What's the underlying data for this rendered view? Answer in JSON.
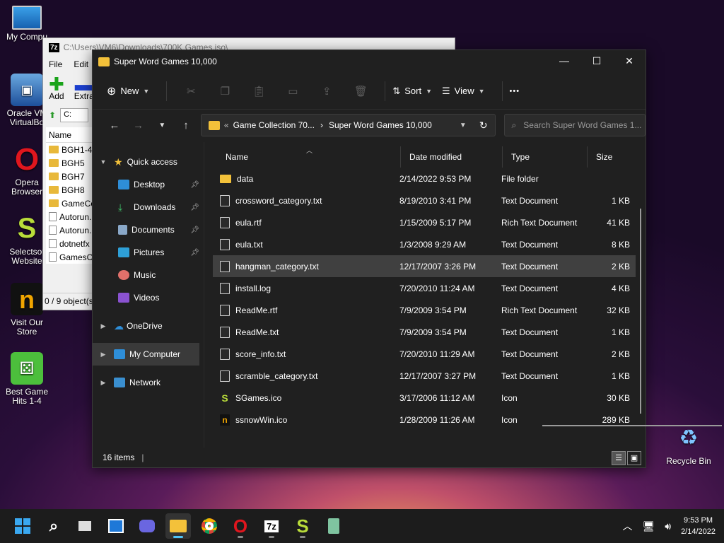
{
  "desktop": {
    "icons": [
      {
        "label": "My Compu",
        "icon": "monitor-icon"
      },
      {
        "label": "Oracle VM VirtualBo",
        "icon": "virtualbox-icon"
      },
      {
        "label": "Opera Browser",
        "icon": "opera-icon"
      },
      {
        "label": "Selectsof Website",
        "icon": "selectsoft-icon"
      },
      {
        "label": "Visit Our Store",
        "icon": "store-icon"
      },
      {
        "label": "Best Game Hits 1-4",
        "icon": "dice-icon"
      },
      {
        "label": "Recycle Bin",
        "icon": "recycle-bin-icon"
      }
    ]
  },
  "zip_window": {
    "title": "C:\\Users\\VM6\\Downloads\\700K Games.iso\\",
    "logo": "7z",
    "menu": [
      "File",
      "Edit"
    ],
    "toolbar": {
      "add": "Add",
      "extract": "Extra"
    },
    "addr_label": "C:",
    "list_header": "Name",
    "items": [
      "BGH1-4",
      "BGH5",
      "BGH7",
      "BGH8",
      "GameCo",
      "Autorun.",
      "Autorun.",
      "dotnetfx",
      "GamesC"
    ],
    "status": "0 / 9 object(s"
  },
  "explorer": {
    "title": "Super Word Games 10,000",
    "toolbar": {
      "new": "New",
      "sort": "Sort",
      "view": "View",
      "more": "•••"
    },
    "breadcrumb": {
      "prefix": "«",
      "parent": "Game Collection 70...",
      "current": "Super Word Games 10,000"
    },
    "search_placeholder": "Search Super Word Games 1...",
    "nav": {
      "quick_access": "Quick access",
      "items": [
        "Desktop",
        "Downloads",
        "Documents",
        "Pictures",
        "Music",
        "Videos"
      ],
      "onedrive": "OneDrive",
      "my_computer": "My Computer",
      "network": "Network"
    },
    "columns": {
      "name": "Name",
      "date": "Date modified",
      "type": "Type",
      "size": "Size"
    },
    "files": [
      {
        "name": "data",
        "date": "2/14/2022 9:53 PM",
        "type": "File folder",
        "size": "",
        "kind": "folder"
      },
      {
        "name": "crossword_category.txt",
        "date": "8/19/2010 3:41 PM",
        "type": "Text Document",
        "size": "1 KB",
        "kind": "doc"
      },
      {
        "name": "eula.rtf",
        "date": "1/15/2009 5:17 PM",
        "type": "Rich Text Document",
        "size": "41 KB",
        "kind": "doc"
      },
      {
        "name": "eula.txt",
        "date": "1/3/2008 9:29 AM",
        "type": "Text Document",
        "size": "8 KB",
        "kind": "doc"
      },
      {
        "name": "hangman_category.txt",
        "date": "12/17/2007 3:26 PM",
        "type": "Text Document",
        "size": "2 KB",
        "kind": "doc"
      },
      {
        "name": "install.log",
        "date": "7/20/2010 11:24 AM",
        "type": "Text Document",
        "size": "4 KB",
        "kind": "doc"
      },
      {
        "name": "ReadMe.rtf",
        "date": "7/9/2009 3:54 PM",
        "type": "Rich Text Document",
        "size": "32 KB",
        "kind": "doc"
      },
      {
        "name": "ReadMe.txt",
        "date": "7/9/2009 3:54 PM",
        "type": "Text Document",
        "size": "1 KB",
        "kind": "doc"
      },
      {
        "name": "score_info.txt",
        "date": "7/20/2010 11:29 AM",
        "type": "Text Document",
        "size": "2 KB",
        "kind": "doc"
      },
      {
        "name": "scramble_category.txt",
        "date": "12/17/2007 3:27 PM",
        "type": "Text Document",
        "size": "1 KB",
        "kind": "doc"
      },
      {
        "name": "SGames.ico",
        "date": "3/17/2006 11:12 AM",
        "type": "Icon",
        "size": "30 KB",
        "kind": "ico-s"
      },
      {
        "name": "ssnowWin.ico",
        "date": "1/28/2009 11:26 AM",
        "type": "Icon",
        "size": "289 KB",
        "kind": "ico-n"
      }
    ],
    "selected_index": 4,
    "status": "16 items"
  },
  "taskbar": {
    "time": "9:53 PM",
    "date": "2/14/2022"
  }
}
